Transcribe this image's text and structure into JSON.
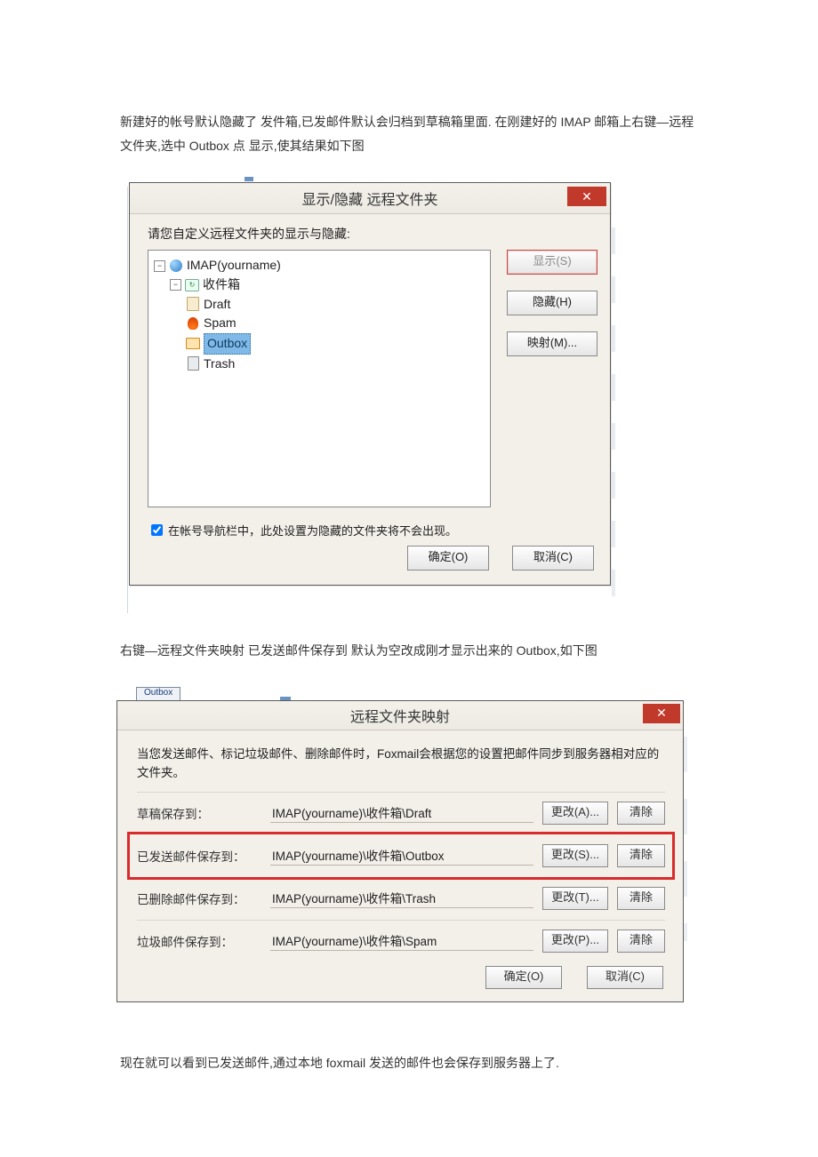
{
  "paragraphs": {
    "p1": "新建好的帐号默认隐藏了 发件箱,已发邮件默认会归档到草稿箱里面. 在刚建好的 IMAP 邮箱上右键—远程文件夹,选中 Outbox 点 显示,使其结果如下图",
    "p2": "右键—远程文件夹映射 已发送邮件保存到 默认为空改成刚才显示出来的 Outbox,如下图",
    "p3": "现在就可以看到已发送邮件,通过本地 foxmail 发送的邮件也会保存到服务器上了."
  },
  "dlg1": {
    "title": "显示/隐藏 远程文件夹",
    "prompt": "请您自定义远程文件夹的显示与隐藏:",
    "tree": {
      "root": "IMAP(yourname)",
      "inbox": "收件箱",
      "draft": "Draft",
      "spam": "Spam",
      "outbox": "Outbox",
      "trash": "Trash"
    },
    "buttons": {
      "show": "显示(S)",
      "hide": "隐藏(H)",
      "map": "映射(M)..."
    },
    "checkbox": "在帐号导航栏中，此处设置为隐藏的文件夹将不会出现。",
    "ok": "确定(O)",
    "cancel": "取消(C)"
  },
  "dlg2": {
    "tabLabel": "Outbox",
    "title": "远程文件夹映射",
    "desc": "当您发送邮件、标记垃圾邮件、删除邮件时，Foxmail会根据您的设置把邮件同步到服务器相对应的文件夹。",
    "rows": [
      {
        "label": "草稿保存到：",
        "path": "IMAP(yourname)\\收件箱\\Draft",
        "change": "更改(A)...",
        "clear": "清除"
      },
      {
        "label": "已发送邮件保存到：",
        "path": "IMAP(yourname)\\收件箱\\Outbox",
        "change": "更改(S)...",
        "clear": "清除",
        "highlight": true
      },
      {
        "label": "已删除邮件保存到：",
        "path": "IMAP(yourname)\\收件箱\\Trash",
        "change": "更改(T)...",
        "clear": "清除"
      },
      {
        "label": "垃圾邮件保存到：",
        "path": "IMAP(yourname)\\收件箱\\Spam",
        "change": "更改(P)...",
        "clear": "清除"
      }
    ],
    "ok": "确定(O)",
    "cancel": "取消(C)"
  }
}
